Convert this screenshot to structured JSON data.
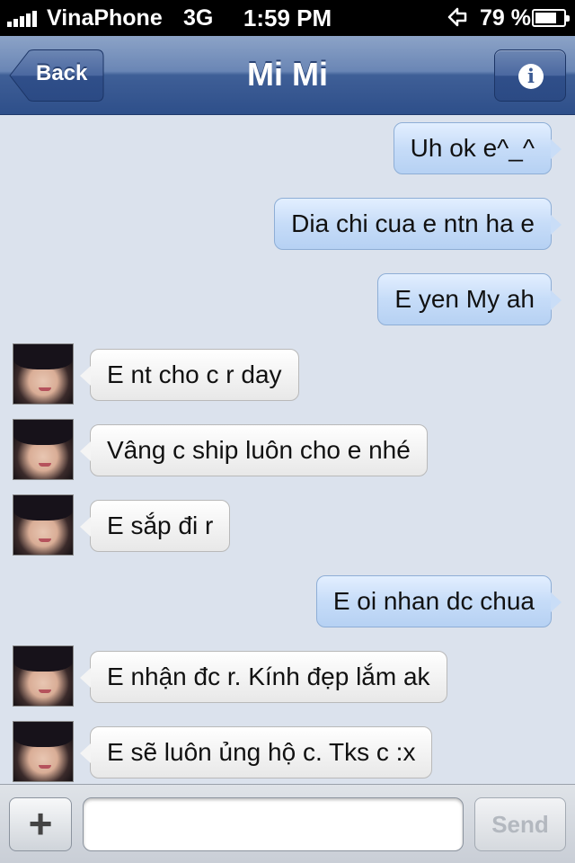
{
  "status_bar": {
    "carrier": "VinaPhone",
    "network": "3G",
    "time": "1:59 PM",
    "battery_percent": "79 %",
    "battery_level": 0.79,
    "icons": [
      "signal-bars-icon",
      "location-arrow-icon",
      "battery-icon"
    ]
  },
  "nav": {
    "title": "Mi Mi",
    "back_label": "Back",
    "info_icon": "info-icon"
  },
  "messages": [
    {
      "side": "out",
      "text": "Uh ok e^_^"
    },
    {
      "side": "out",
      "text": "Dia chi cua e ntn ha e"
    },
    {
      "side": "out",
      "text": "E yen My ah"
    },
    {
      "side": "in",
      "text": "E nt cho c r day"
    },
    {
      "side": "in",
      "text": "Vâng c ship luôn cho e nhé"
    },
    {
      "side": "in",
      "text": "E sắp đi r"
    },
    {
      "side": "out",
      "text": "E oi nhan dc chua"
    },
    {
      "side": "in",
      "text": "E nhận đc r. Kính đẹp lắm ak"
    },
    {
      "side": "in",
      "text": "E sẽ luôn ủng hộ c. Tks c :x"
    }
  ],
  "input_bar": {
    "plus_label": "+",
    "input_value": "",
    "send_label": "Send"
  },
  "colors": {
    "nav_blue": "#3f5f97",
    "outgoing_bubble": "#c6dcf8",
    "incoming_bubble": "#f1f1f1",
    "background": "#dbe2ed"
  }
}
